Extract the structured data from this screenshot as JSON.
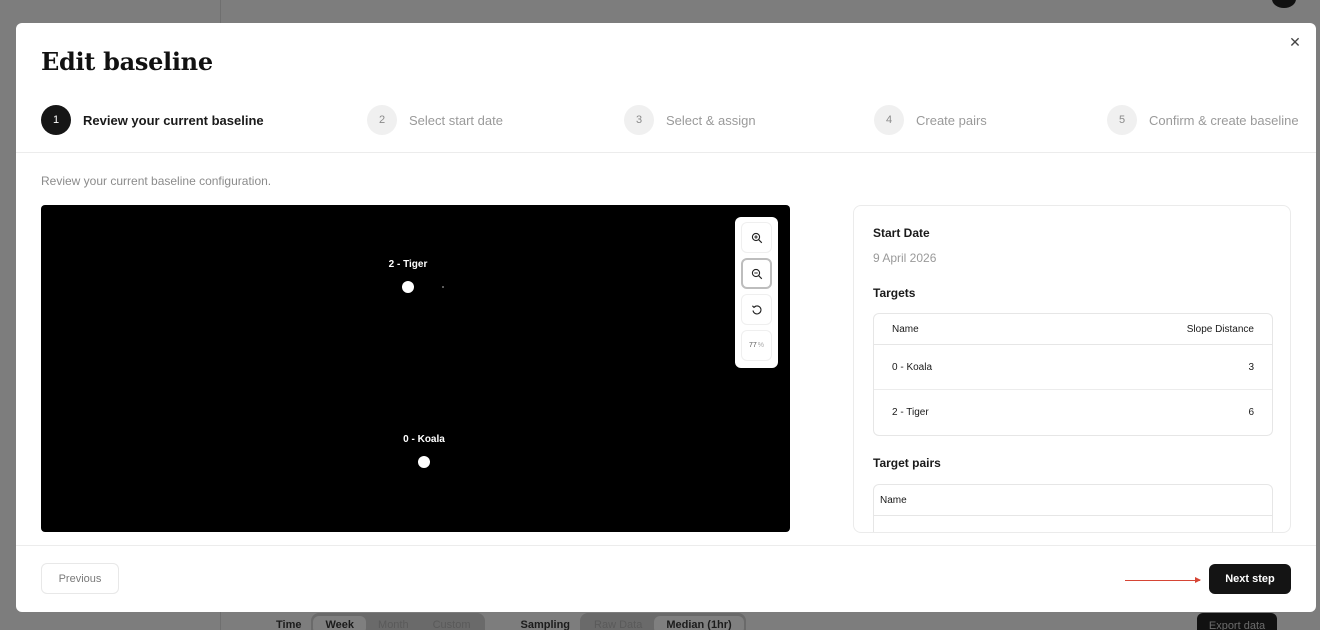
{
  "background": {
    "toolbar": {
      "time_label": "Time",
      "time_options": [
        "Week",
        "Month",
        "Custom"
      ],
      "time_selected": "Week",
      "sampling_label": "Sampling",
      "sampling_options": [
        "Raw Data",
        "Median (1hr)"
      ],
      "sampling_selected": "Median (1hr)",
      "export_label": "Export data"
    }
  },
  "modal": {
    "title": "Edit baseline",
    "close_icon": "close-icon",
    "steps": [
      {
        "number": "1",
        "label": "Review your current baseline",
        "active": true
      },
      {
        "number": "2",
        "label": "Select start date",
        "active": false
      },
      {
        "number": "3",
        "label": "Select & assign",
        "active": false
      },
      {
        "number": "4",
        "label": "Create pairs",
        "active": false
      },
      {
        "number": "5",
        "label": "Confirm & create baseline",
        "active": false
      }
    ],
    "subtitle": "Review your current baseline configuration.",
    "canvas": {
      "markers": [
        {
          "label": "2 - Tiger"
        },
        {
          "label": "0 - Koala"
        }
      ],
      "zoom_controls": {
        "zoom_in_icon": "zoom-in-icon",
        "zoom_out_icon": "zoom-out-icon",
        "reset_icon": "reset-rotate-icon",
        "zoom_level": "77",
        "zoom_unit": "%"
      }
    },
    "info": {
      "start_date_label": "Start Date",
      "start_date_value": "9 April 2026",
      "targets_label": "Targets",
      "targets_columns": [
        "Name",
        "Slope Distance"
      ],
      "targets_rows": [
        {
          "name": "0 - Koala",
          "slope_distance": "3"
        },
        {
          "name": "2 - Tiger",
          "slope_distance": "6"
        }
      ],
      "pairs_label": "Target pairs",
      "pairs_columns": [
        "Name"
      ]
    },
    "footer": {
      "previous_label": "Previous",
      "next_label": "Next step"
    }
  },
  "colors": {
    "primary_button": "#141414",
    "overlay": "#7d7d7d",
    "annotation_arrow": "#d64535"
  }
}
